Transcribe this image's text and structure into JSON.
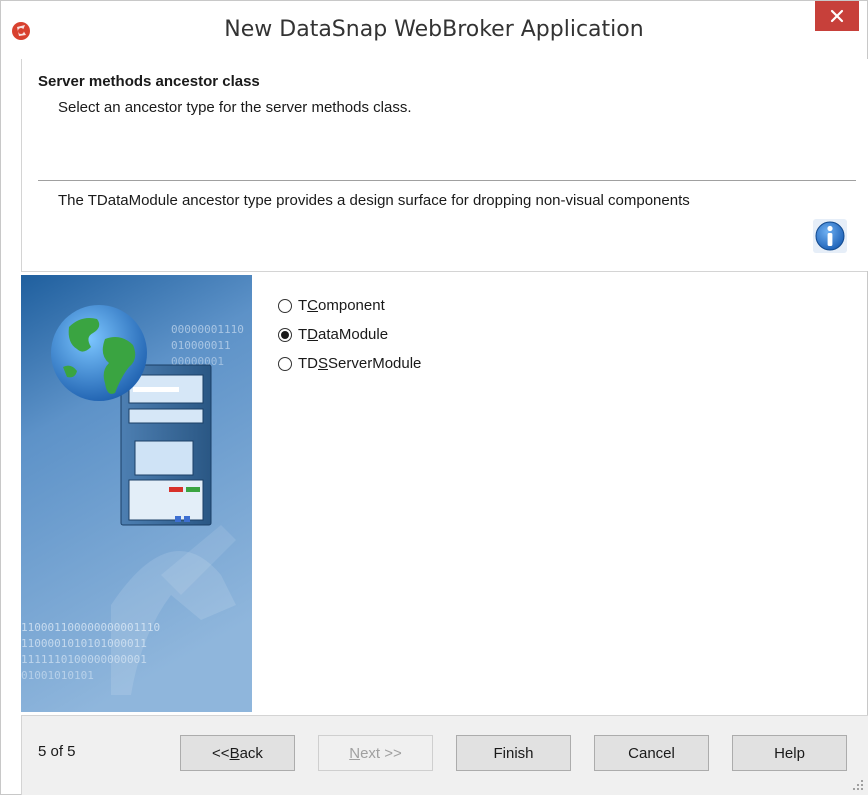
{
  "window": {
    "title": "New DataSnap WebBroker Application",
    "close_glyph": "×"
  },
  "header": {
    "title": "Server methods ancestor class",
    "subtitle": "Select an ancestor type for the server methods class.",
    "description": "The TDataModule ancestor type provides a design surface for dropping non-visual components",
    "info_icon": "info-icon"
  },
  "side_image": {
    "binary_top": [
      "00000001110",
      "010000011",
      "00000001"
    ],
    "binary_bottom": [
      "110001100000000001110",
      "1100001010101000011",
      "1111110100000000001",
      "01001010101"
    ]
  },
  "options": [
    {
      "pre": "T",
      "mnemonic": "C",
      "post": "omponent",
      "checked": false
    },
    {
      "pre": "T",
      "mnemonic": "D",
      "post": "ataModule",
      "checked": true
    },
    {
      "pre": "TD",
      "mnemonic": "S",
      "post": "ServerModule",
      "checked": false
    }
  ],
  "footer": {
    "page_count": "5 of 5",
    "back": {
      "pre": "<< ",
      "mnemonic": "B",
      "post": "ack"
    },
    "next": {
      "pre": "",
      "mnemonic": "N",
      "post": "ext >>"
    },
    "finish": "Finish",
    "cancel": "Cancel",
    "help": "Help"
  },
  "colors": {
    "close_button": "#c7403a",
    "footer_bg": "#f0f0f0",
    "side_bg_top": "#1f5f9e",
    "side_bg_bottom": "#8fb6dc"
  }
}
